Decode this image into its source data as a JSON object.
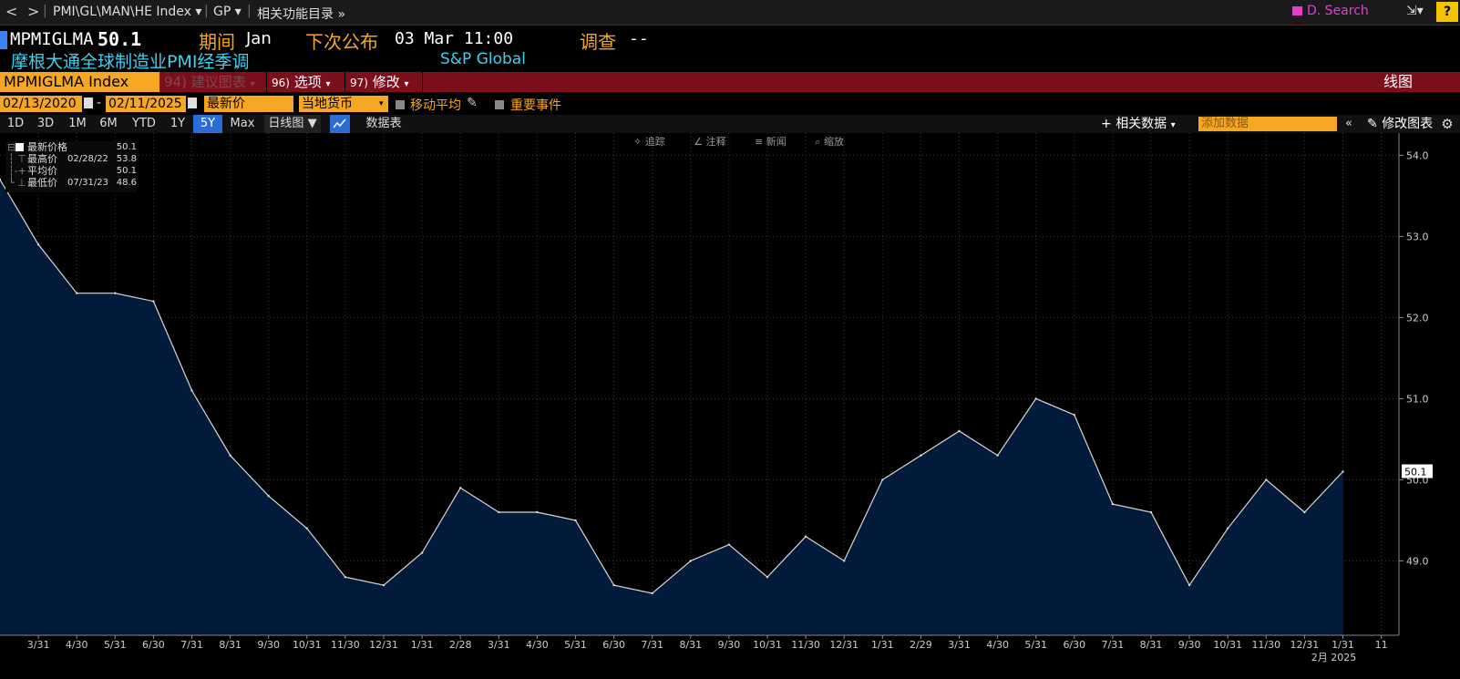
{
  "nav": {
    "back": "<",
    "forward": ">",
    "breadcrumb": "PMI\\GL\\MAN\\HE Index",
    "market": "GP",
    "related_functions": "相关功能目录",
    "search": "D. Search",
    "help": "?"
  },
  "header": {
    "ticker": "MPMIGLMA",
    "last_value": "50.1",
    "period_label": "期间",
    "period_value": "Jan",
    "next_release_label": "下次公布",
    "next_release_value": "03 Mar 11:00",
    "survey_label": "调查",
    "survey_value": "--",
    "description": "摩根大通全球制造业PMI经季调",
    "source": "S&P Global"
  },
  "command_bar": {
    "ticker_field": "MPMIGLMA Index",
    "suggest_num": "94)",
    "suggest_label": "建议图表",
    "options_num": "96)",
    "options_label": "选项",
    "modify_num": "97)",
    "modify_label": "修改",
    "chart_type": "线图"
  },
  "options_row": {
    "start_date": "02/13/2020",
    "date_sep": "-",
    "end_date": "02/11/2025",
    "price_field": "最新价",
    "currency_field": "当地货币",
    "moving_avg": "移动平均",
    "events": "重要事件"
  },
  "periods": [
    "1D",
    "3D",
    "1M",
    "6M",
    "YTD",
    "1Y",
    "5Y",
    "Max"
  ],
  "active_period": "5Y",
  "frequency": "日线图",
  "data_table": "数据表",
  "related_data": "相关数据",
  "add_data_placeholder": "添加数据",
  "modify_chart": "修改图表",
  "chart_tools": [
    "追踪",
    "注释",
    "新闻",
    "缩放"
  ],
  "legend": [
    {
      "name": "最新价格",
      "date": "",
      "value": "50.1"
    },
    {
      "name": "最高价",
      "date": "02/28/22",
      "value": "53.8"
    },
    {
      "name": "平均价",
      "date": "",
      "value": "50.1"
    },
    {
      "name": "最低价",
      "date": "07/31/23",
      "value": "48.6"
    }
  ],
  "colors": {
    "line": "#d8d8d8",
    "area": "#021b3a",
    "accent_orange": "#f5a623",
    "command_red": "#7d0f1c",
    "cyan_text": "#3fd0f0",
    "active_period": "#2a6dd6"
  },
  "chart_data": {
    "type": "area",
    "title": "",
    "xlabel": "",
    "ylabel": "",
    "ylim": [
      48.1,
      54.2
    ],
    "y_ticks": [
      "54.0",
      "53.0",
      "52.0",
      "51.0",
      "50.0",
      "49.0"
    ],
    "last_label": "50.1",
    "x_labels": [
      "3/31",
      "4/30",
      "5/31",
      "6/30",
      "7/31",
      "8/31",
      "9/30",
      "10/31",
      "11/30",
      "12/31",
      "1/31",
      "2/28",
      "3/31",
      "4/30",
      "5/31",
      "6/30",
      "7/31",
      "8/31",
      "9/30",
      "10/31",
      "11/30",
      "12/31",
      "1/31",
      "2/29",
      "3/31",
      "4/30",
      "5/31",
      "6/30",
      "7/31",
      "8/31",
      "9/30",
      "10/31",
      "11/30",
      "12/31",
      "1/31",
      "11"
    ],
    "x_footer": "2月 2025",
    "series": [
      {
        "values": [
          53.7,
          52.9,
          52.3,
          52.3,
          52.2,
          51.1,
          50.3,
          49.8,
          49.4,
          48.8,
          48.7,
          49.1,
          49.9,
          49.6,
          49.6,
          49.5,
          48.7,
          48.6,
          49.0,
          49.2,
          48.8,
          49.3,
          49.0,
          50.0,
          50.3,
          50.6,
          50.3,
          51.0,
          50.8,
          49.7,
          49.6,
          48.7,
          49.4,
          50.0,
          49.6,
          50.1
        ]
      }
    ]
  }
}
